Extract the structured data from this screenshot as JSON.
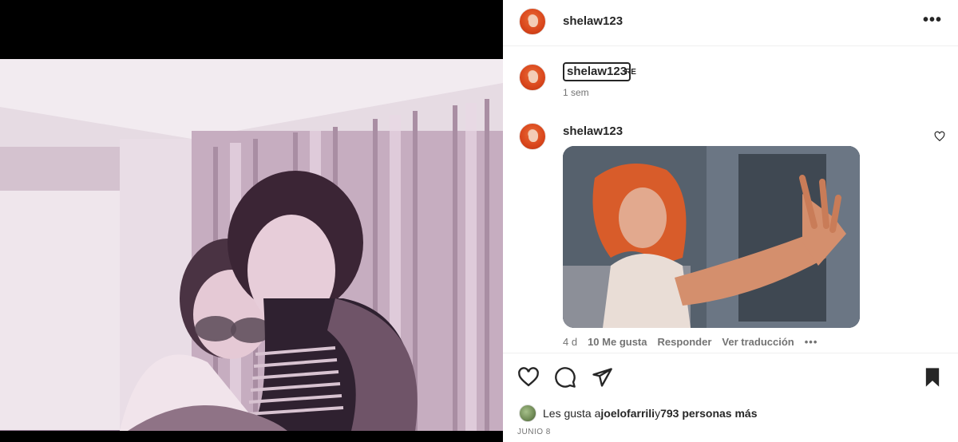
{
  "post": {
    "author": "shelaw123",
    "more_label": "•••"
  },
  "caption": {
    "username": "shelaw123",
    "suffix": "RE",
    "time": "1 sem"
  },
  "comment": {
    "username": "shelaw123",
    "age": "4 d",
    "likes": "10 Me gusta",
    "reply": "Responder",
    "translate": "Ver traducción",
    "more": "•••"
  },
  "likes_line": {
    "prefix": "Les gusta a ",
    "user": "joelofarrili",
    "middle": " y ",
    "count": "793 personas más"
  },
  "date": "JUNIO 8",
  "icons": {
    "like": "heart-icon",
    "comment": "comment-icon",
    "share": "send-icon",
    "save": "bookmark-icon",
    "more": "more-options-icon"
  },
  "colors": {
    "text": "#262626",
    "secondary": "#737373",
    "divider": "#efefef"
  }
}
